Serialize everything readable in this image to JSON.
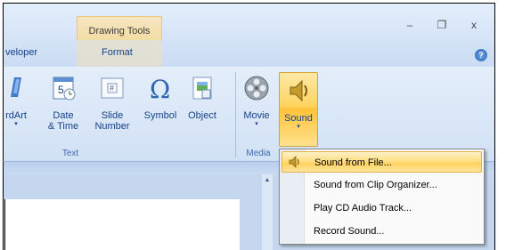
{
  "titlebar": {
    "context_tab": "Drawing Tools",
    "minimize_glyph": "–",
    "restore_glyph": "❐",
    "close_glyph": "x"
  },
  "tabs": [
    {
      "label": "veloper"
    },
    {
      "label": "Format"
    }
  ],
  "help_glyph": "?",
  "ribbon": {
    "items": [
      {
        "label_line1": "rdArt",
        "label_line2": "",
        "has_arrow": true
      },
      {
        "label_line1": "Date",
        "label_line2": "& Time",
        "has_arrow": false
      },
      {
        "label_line1": "Slide",
        "label_line2": "Number",
        "has_arrow": false
      },
      {
        "label_line1": "Symbol",
        "label_line2": "",
        "has_arrow": false
      },
      {
        "label_line1": "Object",
        "label_line2": "",
        "has_arrow": false
      },
      {
        "label_line1": "Movie",
        "label_line2": "",
        "has_arrow": true
      },
      {
        "label_line1": "Sound",
        "label_line2": "",
        "has_arrow": true
      }
    ],
    "groups": {
      "text": "Text",
      "media": "Media"
    },
    "date_icon_number": "5",
    "slide_number_glyph": "#",
    "symbol_glyph": "Ω",
    "arrow_glyph": "▾"
  },
  "menu": {
    "items": [
      {
        "label": "Sound from File...",
        "highlighted": true
      },
      {
        "label": "Sound from Clip Organizer...",
        "highlighted": false
      },
      {
        "label": "Play CD Audio Track...",
        "highlighted": false
      },
      {
        "label": "Record Sound...",
        "highlighted": false
      }
    ]
  },
  "scroll_up_glyph": "▲",
  "colors": {
    "accent_highlight": "#ffd561",
    "ribbon_blue": "#d1e1f5",
    "context_tab": "#f2dca3"
  }
}
